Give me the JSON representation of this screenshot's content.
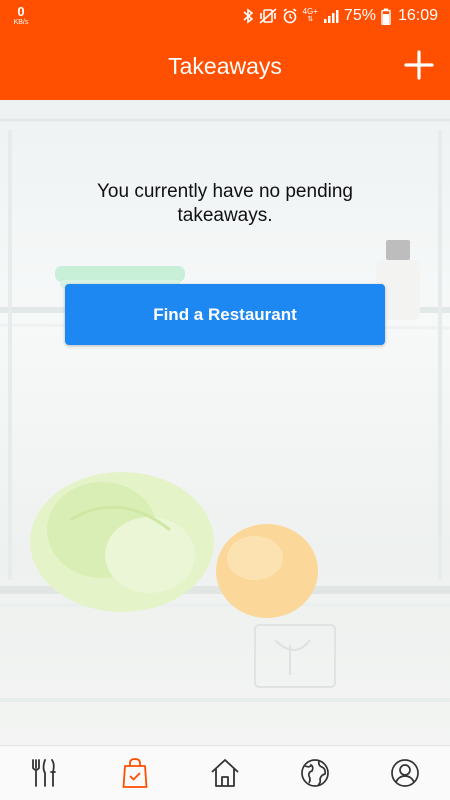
{
  "status_bar": {
    "kb_value": "0",
    "kb_unit": "KB/s",
    "network": "4G+",
    "battery_percent": "75%",
    "time": "16:09",
    "icons": [
      "bluetooth-icon",
      "vibrate-icon",
      "alarm-icon",
      "signal-icon",
      "battery-icon"
    ]
  },
  "app_bar": {
    "title": "Takeaways",
    "add_icon": "plus-icon"
  },
  "main": {
    "empty_message": "You currently have no pending takeaways.",
    "find_button_label": "Find a Restaurant"
  },
  "bottom_nav": {
    "items": [
      {
        "icon": "fork-knife-icon",
        "active": false
      },
      {
        "icon": "shopping-bag-icon",
        "active": true
      },
      {
        "icon": "home-icon",
        "active": false
      },
      {
        "icon": "globe-icon",
        "active": false
      },
      {
        "icon": "profile-icon",
        "active": false
      }
    ]
  },
  "colors": {
    "brand": "#ff4f00",
    "button": "#1e88f2",
    "nav_icon": "#333333",
    "nav_active": "#ff4f00"
  }
}
